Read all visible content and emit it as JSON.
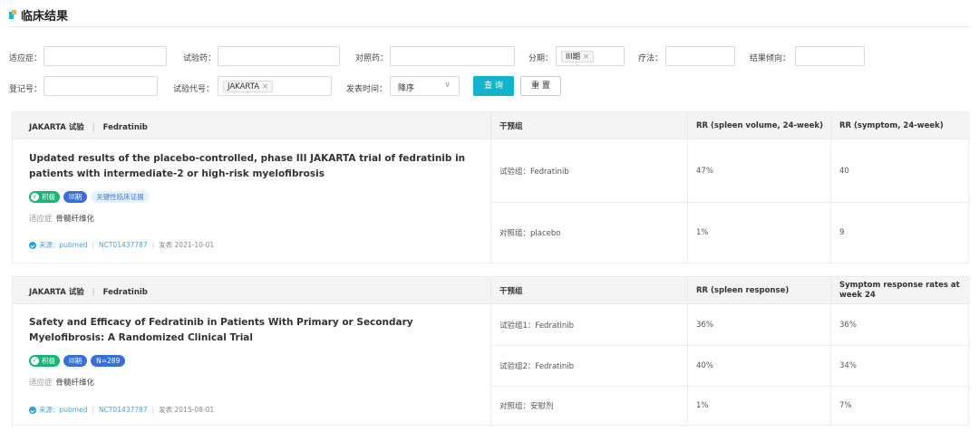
{
  "header": {
    "title": "临床结果"
  },
  "filters": {
    "indication_label": "适应症：",
    "drug_label": "试验药：",
    "control_label": "对照药：",
    "phase_label": "分期：",
    "phase_tag": "III期",
    "therapy_label": "疗法：",
    "trend_label": "结果倾向：",
    "reg_label": "登记号：",
    "code_label": "试验代号：",
    "code_tag": "JAKARTA",
    "date_label": "发表时间：",
    "date_value": "降序",
    "tag_remove": "×",
    "query_btn": "查 询",
    "reset_btn": "重 置"
  },
  "cards": [
    {
      "trial": "JAKARTA 试验",
      "sep": "|",
      "drug": "Fedratinib",
      "title": "Updated results of the placebo-controlled, phase III JAKARTA trial of fedratinib in patients with intermediate-2 or high-risk myelofibrosis",
      "badges": {
        "pos": "积极",
        "phase": "III期",
        "extra": "关键性临床证据"
      },
      "indication_label": "适应症",
      "indication": "骨髓纤维化",
      "source": "来源：pubmed",
      "nct": "NCT01437787",
      "date": "发表  2021-10-01",
      "columns": [
        "干预组",
        "RR (spleen volume, 24-week)",
        "RR (symptom, 24-week)"
      ],
      "rows": [
        [
          "试验组：Fedratinib",
          "47%",
          "40"
        ],
        [
          "对照组：placebo",
          "1%",
          "9"
        ]
      ]
    },
    {
      "trial": "JAKARTA 试验",
      "sep": "|",
      "drug": "Fedratinib",
      "title": "Safety and Efficacy of Fedratinib in Patients With Primary or Secondary Myelofibrosis: A Randomized Clinical Trial",
      "badges": {
        "pos": "积极",
        "phase": "III期",
        "extra": "N=289"
      },
      "indication_label": "适应症",
      "indication": "骨髓纤维化",
      "source": "来源：pubmed",
      "nct": "NCT01437787",
      "date": "发表  2015-08-01",
      "columns": [
        "干预组",
        "RR (spleen response)",
        "Symptom response rates at week 24"
      ],
      "rows": [
        [
          "试验组1：Fedratinib",
          "36%",
          "36%"
        ],
        [
          "试验组2：Fedratinib",
          "40%",
          "34%"
        ],
        [
          "对照组：安慰剂",
          "1%",
          "7%"
        ]
      ]
    }
  ],
  "colors": {
    "accent": "#13b3cc",
    "positive": "#19b479",
    "phase": "#3a6fd8",
    "link": "#4aa3d8"
  }
}
